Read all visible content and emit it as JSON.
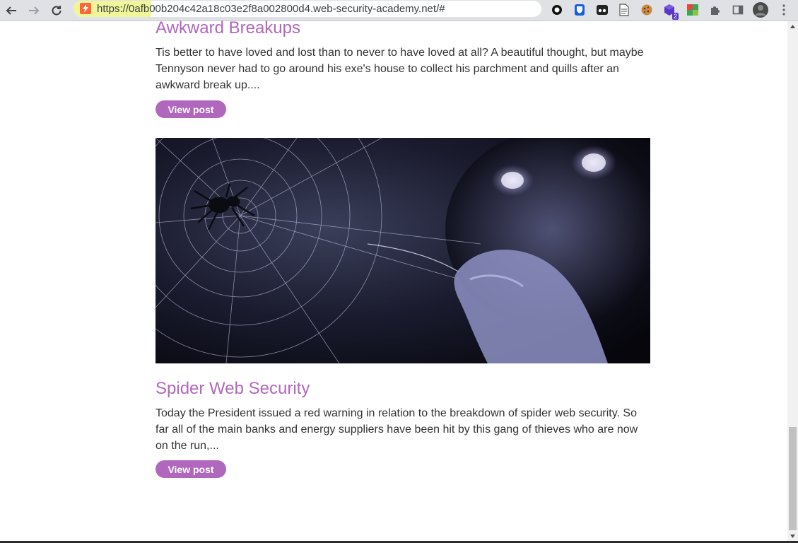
{
  "browser": {
    "url": "https://0afb00b204c42a18c03e2f8a002800d4.web-security-academy.net/#",
    "extensions": [
      "circle-icon",
      "shield-icon",
      "ghost-icon",
      "document-icon",
      "cookie-icon",
      "cube-icon",
      "grid-icon",
      "puzzle-icon",
      "sidepanel-icon",
      "avatar",
      "kebab-menu-icon"
    ],
    "extension_badge": "2",
    "colors": {
      "toolbar": "#dfe1e5",
      "url_highlight": "#f0f59a",
      "site_icon": "#ff6633"
    }
  },
  "posts": [
    {
      "title": "Awkward Breakups",
      "excerpt": "Tis better to have loved and lost than to never to have loved at all? A beautiful thought, but maybe Tennyson never had to go around his exe's house to collect his parchment and quills after an awkward break up....",
      "button": "View post"
    },
    {
      "title": "Spider Web Security",
      "excerpt": "Today the President issued a red warning in relation to the breakdown of spider web security. So far all of the main banks and energy suppliers have been hit by this gang of thieves who are now on the run,...",
      "button": "View post",
      "image": "spider-web-image"
    }
  ],
  "theme": {
    "accent": "#b167bd",
    "text": "#333332"
  }
}
